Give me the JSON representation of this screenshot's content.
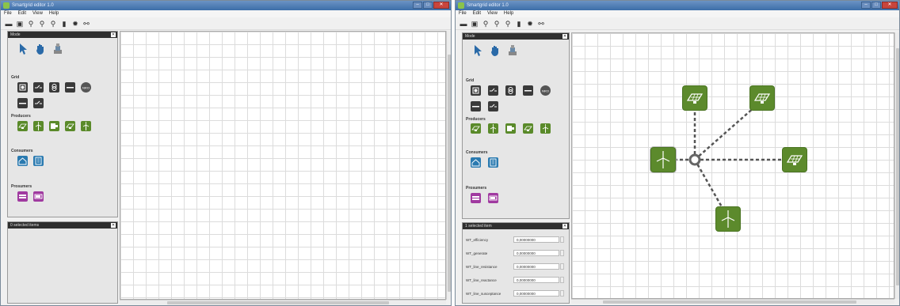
{
  "left_window": {
    "title": "Smartgrid editor 1.0",
    "menu": [
      "File",
      "Edit",
      "View",
      "Help"
    ],
    "palette": {
      "header": "Mode",
      "sections": {
        "grid": "Grid",
        "producers": "Producers",
        "consumers": "Consumers",
        "prosumers": "Prosumers"
      }
    },
    "selection_panel": {
      "header": "0 selected items"
    }
  },
  "right_window": {
    "title": "Smartgrid editor 1.0",
    "menu": [
      "File",
      "Edit",
      "View",
      "Help"
    ],
    "palette": {
      "header": "Mode",
      "sections": {
        "grid": "Grid",
        "producers": "Producers",
        "consumers": "Consumers",
        "prosumers": "Prosumers"
      }
    },
    "selection_panel": {
      "header": "1 selected item",
      "properties": [
        {
          "name": "WT_efficiency",
          "value": "0,00000000"
        },
        {
          "name": "WT_generate",
          "value": "0,00000000"
        },
        {
          "name": "WT_line_resistance",
          "value": "0,00000000"
        },
        {
          "name": "WT_line_reactance",
          "value": "0,00000000"
        },
        {
          "name": "WT_line_susceptance",
          "value": "0,00000000"
        }
      ]
    }
  },
  "grid_tool_labels": {
    "nro": "NRO"
  },
  "colors": {
    "producer": "#5c8a2c",
    "consumer": "#2a7ab0",
    "prosumer": "#a03aa0",
    "grid": "#3a3a3a",
    "header": "#2e2e2e"
  },
  "icons": {
    "toolbar": [
      "folder-icon",
      "save-icon",
      "zoom-in-icon",
      "zoom-out-icon",
      "zoom-fit-icon",
      "delete-icon",
      "settings-icon",
      "connect-icon"
    ],
    "mode": [
      "pointer-icon",
      "pan-hand-icon",
      "stamp-icon"
    ],
    "producers": [
      "pv-panel-icon",
      "wind-turbine-icon",
      "generator-icon",
      "pv-panel-icon",
      "wind-turbine-icon"
    ],
    "consumers": [
      "house-icon",
      "building-icon"
    ],
    "prosumers": [
      "storage-icon",
      "battery-icon"
    ]
  }
}
